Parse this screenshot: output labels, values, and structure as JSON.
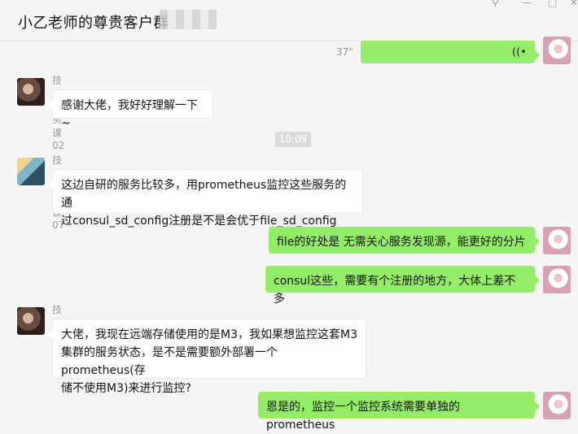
{
  "window": {
    "title": "小乙老师的尊贵客户群",
    "controls": {
      "pin": "⚲",
      "min": "—",
      "max": "□",
      "close": "✕"
    }
  },
  "messages": [
    {
      "side": "right",
      "type": "voice",
      "duration": "37\"",
      "icon": "voice-icon"
    },
    {
      "side": "left",
      "sender": "技术_买课02",
      "text": "感谢大佬，我好好理解一下~"
    },
    {
      "timestamp": "10:09"
    },
    {
      "side": "left",
      "sender": "技术_买课07",
      "lines": [
        "这边自研的服务比较多，用prometheus监控这些服务的通",
        "过consul_sd_config注册是不是会优于file_sd_config"
      ]
    },
    {
      "side": "right",
      "text": "file的好处是 无需关心服务发现源，能更好的分片"
    },
    {
      "side": "right",
      "text": "consul这些，需要有个注册的地方，大体上差不多"
    },
    {
      "side": "left",
      "sender": "技术_买课02",
      "lines": [
        "大佬，我现在远端存储使用的是M3，我如果想监控这套M3",
        "集群的服务状态，是不是需要额外部署一个prometheus(存",
        "储不使用M3)来进行监控?"
      ]
    },
    {
      "side": "right",
      "text": "恩是的，监控一个监控系统需要单独的prometheus"
    }
  ]
}
